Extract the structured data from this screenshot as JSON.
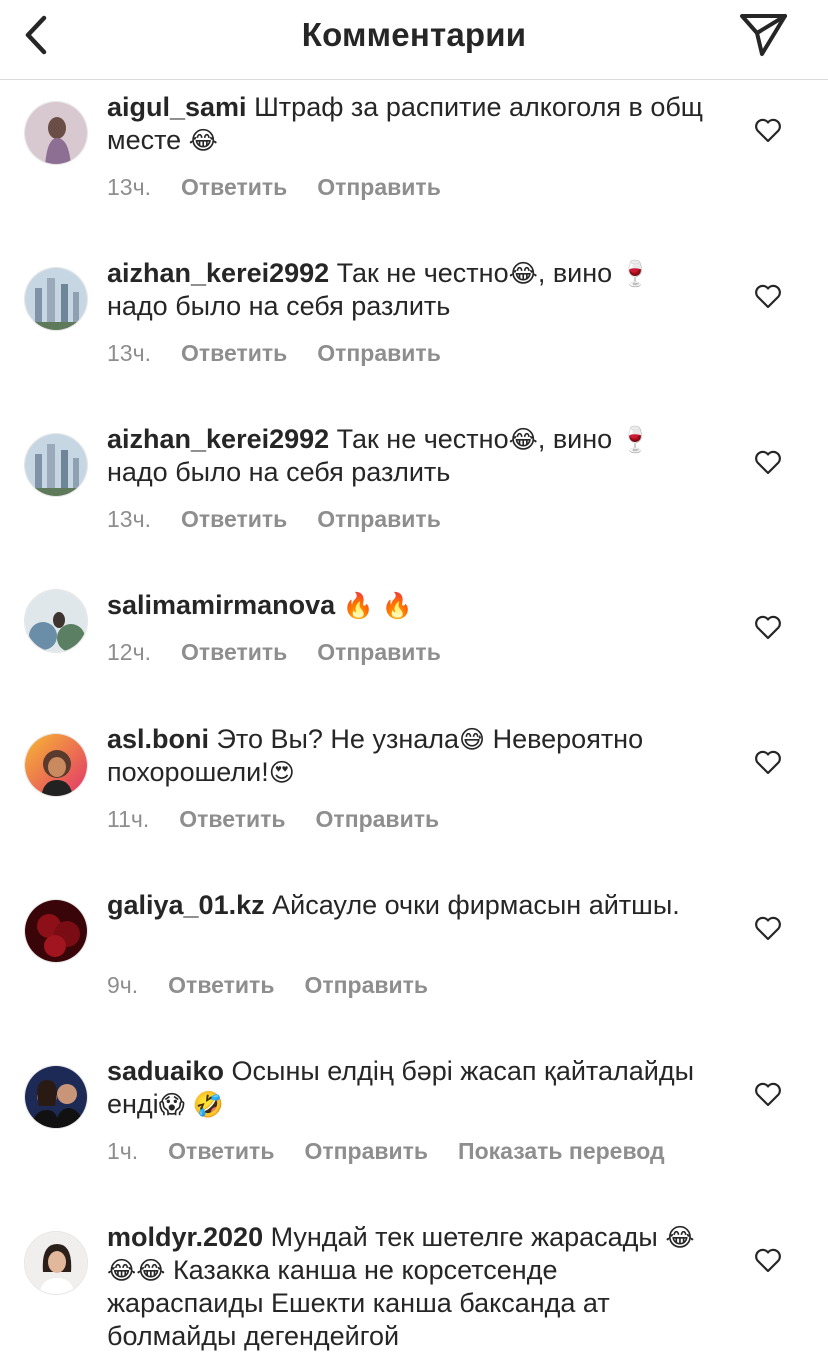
{
  "header": {
    "title": "Комментарии",
    "back_icon": "chevron-left-icon",
    "send_icon": "paper-plane-icon"
  },
  "actions": {
    "reply": "Ответить",
    "send": "Отправить",
    "translate": "Показать перевод"
  },
  "comments": [
    {
      "username": "aigul_sami",
      "text": " Штраф за распитие алкоголя в общ месте ",
      "emoji": "😂",
      "time": "13ч.",
      "avatar_color": "#b8a3b6"
    },
    {
      "username": "aizhan_kerei2992",
      "text": " Так не честно",
      "emoji": "😂",
      "text2": ", вино ",
      "emoji2": "🍷",
      "text3": " надо было на себя разлить",
      "time": "13ч.",
      "avatar_color": "#a9bfcf"
    },
    {
      "username": "aizhan_kerei2992",
      "text": " Так не честно",
      "emoji": "😂",
      "text2": ", вино ",
      "emoji2": "🍷",
      "text3": " надо было на себя разлить",
      "time": "13ч.",
      "avatar_color": "#a9bfcf"
    },
    {
      "username": "salimamirmanova",
      "text": " ",
      "emoji": "🔥 🔥",
      "time": "12ч.",
      "avatar_color": "#6d8a6f"
    },
    {
      "username": "asl.boni",
      "text": " Это Вы? Не узнала",
      "emoji": "😅",
      "text2": " Невероятно похорошели!",
      "emoji2": "😍",
      "time": "11ч.",
      "avatar_color": "#f09433"
    },
    {
      "username": "galiya_01.kz",
      "text": " Айсауле очки фирмасын айтшы.",
      "time": "9ч.",
      "avatar_color": "#6e0d12"
    },
    {
      "username": "saduaiko",
      "text": " Осыны елдің бәрі жасап қайталайды енді",
      "emoji": "😱 🤣",
      "time": "1ч.",
      "avatar_color": "#2b3a66"
    },
    {
      "username": "moldyr.2020",
      "text": " Мундай тек шетелге жарасады ",
      "emoji": "😂😂😂",
      "text2": " Казакка канша не корсетсенде жараспаиды Ешекти канша баксанда ат болмайды дегендейгой",
      "avatar_color": "#e9e4e0"
    }
  ]
}
